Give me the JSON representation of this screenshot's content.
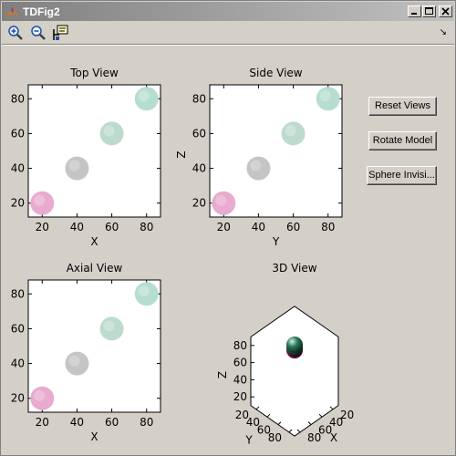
{
  "window": {
    "title": "TDFig2"
  },
  "toolbar": {
    "tools": [
      {
        "icon": "zoom-in-icon"
      },
      {
        "icon": "zoom-out-icon"
      },
      {
        "icon": "data-cursor-icon"
      }
    ],
    "overflow_icon": "dock-arrow-icon",
    "overflow_glyph": "↘"
  },
  "buttons": {
    "reset": "Reset Views",
    "rotate": "Rotate Model",
    "sphere": "Sphere Invisi..."
  },
  "spheres": [
    {
      "pos": [
        20,
        20,
        20
      ],
      "color": "#e8a5cc",
      "color3d": "#d8007a"
    },
    {
      "pos": [
        40,
        40,
        40
      ],
      "color": "#c2c2c2",
      "color3d": "#555555"
    },
    {
      "pos": [
        60,
        60,
        60
      ],
      "color": "#b8d9cb",
      "color3d": "#3a6a56"
    },
    {
      "pos": [
        80,
        80,
        80
      ],
      "color": "#b2dccd",
      "color3d": "#2f7a5e"
    }
  ],
  "chart_data": [
    {
      "type": "scatter",
      "title": "Top View",
      "xlabel": "X",
      "ylabel": "",
      "xticks": [
        "20",
        "40",
        "60",
        "80"
      ],
      "yticks": [
        "20",
        "40",
        "60",
        "80"
      ],
      "x": [
        20,
        40,
        60,
        80
      ],
      "y": [
        20,
        40,
        60,
        80
      ],
      "xlim": [
        12,
        88
      ],
      "ylim": [
        12,
        88
      ]
    },
    {
      "type": "scatter",
      "title": "Side View",
      "xlabel": "Y",
      "ylabel": "Z",
      "xticks": [
        "20",
        "40",
        "60",
        "80"
      ],
      "yticks": [
        "20",
        "40",
        "60",
        "80"
      ],
      "x": [
        20,
        40,
        60,
        80
      ],
      "y": [
        20,
        40,
        60,
        80
      ],
      "xlim": [
        12,
        88
      ],
      "ylim": [
        12,
        88
      ]
    },
    {
      "type": "scatter",
      "title": "Axial View",
      "xlabel": "X",
      "ylabel": "",
      "xticks": [
        "20",
        "40",
        "60",
        "80"
      ],
      "yticks": [
        "20",
        "40",
        "60",
        "80"
      ],
      "x": [
        20,
        40,
        60,
        80
      ],
      "y": [
        20,
        40,
        60,
        80
      ],
      "xlim": [
        12,
        88
      ],
      "ylim": [
        12,
        88
      ]
    },
    {
      "type": "scatter",
      "title": "3D View",
      "xlabel": "X",
      "ylabel": "Y",
      "zlabel": "Z",
      "xticks": [
        "20",
        "40",
        "60",
        "80"
      ],
      "yticks": [
        "20",
        "40",
        "60",
        "80"
      ],
      "zticks": [
        "20",
        "40",
        "60",
        "80"
      ],
      "x": [
        20,
        40,
        60,
        80
      ],
      "y": [
        20,
        40,
        60,
        80
      ],
      "z": [
        20,
        40,
        60,
        80
      ]
    }
  ]
}
